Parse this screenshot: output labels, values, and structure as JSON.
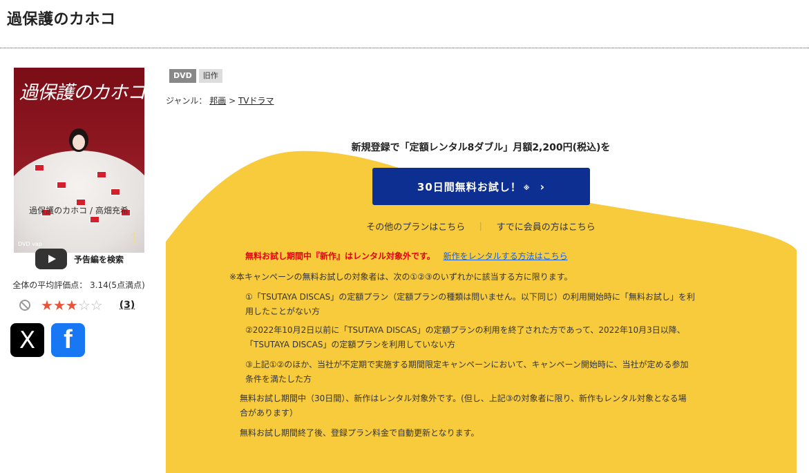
{
  "header": {
    "title": "過保護のカホコ"
  },
  "jacket": {
    "title": "過保護のカホコ",
    "volume": "1",
    "logo": "DVD vap"
  },
  "product": {
    "caption": "過保護のカホコ / 高畑充希",
    "trailer_label": "予告編を検索",
    "rating_summary": "全体の平均評価点： 3.14(5点満点)",
    "rating_value": 3.14,
    "rating_max": 5,
    "stars": "★★★☆☆",
    "review_count": "(3)"
  },
  "share": {
    "x_label": "X",
    "facebook_label": "f"
  },
  "badges": {
    "format": "DVD",
    "status": "旧作"
  },
  "genre": {
    "label": "ジャンル：",
    "category": "邦画",
    "separator": ">",
    "subcategory": "TVドラマ"
  },
  "promo": {
    "headline": "新規登録で「定額レンタル8ダブル」月額2,200円(税込)を",
    "trial_button": "30日間無料お試し！",
    "trial_note": "※",
    "trial_chevron": "›",
    "other_plans": "その他のプランはこちら",
    "separator": "｜",
    "member_login": "すでに会員の方はこちら",
    "notice_red": "無料お試し期間中『新作』はレンタル対象外です。",
    "notice_link": "新作をレンタルする方法はこちら"
  },
  "terms": {
    "intro": "※本キャンペーンの無料お試しの対象者は、次の①②③のいずれかに該当する方に限ります。",
    "item1_line1": "①「TSUTAYA DISCAS」の定額プラン（定額プランの種類は問いません。以下同じ）の利用開始時に「無料お試し」を利",
    "item1_line2": "用したことがない方",
    "item2_line1": "②2022年10月2日以前に「TSUTAYA DISCAS」の定額プランの利用を終了された方であって、2022年10月3日以降、",
    "item2_line2": "「TSUTAYA DISCAS」の定額プランを利用していない方",
    "item3_line1": "③上記①②のほか、当社が不定期で実施する期間限定キャンペーンにおいて、キャンペーン開始時に、当社が定める参加",
    "item3_line2": "条件を満たした方",
    "note1_line1": "無料お試し期間中（30日間）、新作はレンタル対象外です。(但し、上記③の対象者に限り、新作もレンタル対象となる場",
    "note1_line2": "合があります）",
    "note2": "無料お試し期間終了後、登録プラン料金で自動更新となります。"
  },
  "colors": {
    "promo_yellow": "#f7cb3b",
    "trial_blue": "#0d2f91",
    "notice_red": "#e60012",
    "star": "#e8543a"
  }
}
